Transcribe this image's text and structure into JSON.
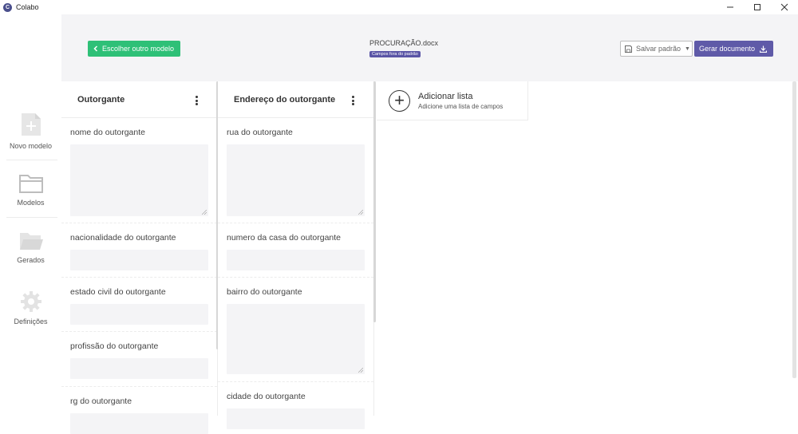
{
  "window": {
    "title": "Colabo",
    "logo_letter": "C"
  },
  "sidebar": {
    "items": [
      {
        "label": "Novo modelo",
        "icon": "new-document-icon"
      },
      {
        "label": "Modelos",
        "icon": "folder-icon"
      },
      {
        "label": "Gerados",
        "icon": "open-folder-icon"
      },
      {
        "label": "Definições",
        "icon": "gear-icon"
      }
    ]
  },
  "header": {
    "choose_label": "Escolher outro modelo",
    "document_name": "PROCURAÇÃO.docx",
    "badge": "Campos fora do padrão",
    "save_label": "Salvar padrão",
    "generate_label": "Gerar documento"
  },
  "columns": [
    {
      "title": "Outorgante",
      "fields": [
        {
          "label": "nome do outorgante",
          "type": "textarea"
        },
        {
          "label": "nacionalidade do outorgante",
          "type": "input"
        },
        {
          "label": "estado civil do outorgante",
          "type": "input"
        },
        {
          "label": "profissão do outorgante",
          "type": "input"
        },
        {
          "label": "rg do outorgante",
          "type": "input"
        }
      ]
    },
    {
      "title": "Endereço do outorgante",
      "fields": [
        {
          "label": "rua do outorgante",
          "type": "textarea"
        },
        {
          "label": "numero da casa do outorgante",
          "type": "input"
        },
        {
          "label": "bairro do outorgante",
          "type": "textarea"
        },
        {
          "label": "cidade do outorgante",
          "type": "input"
        }
      ]
    }
  ],
  "add_list": {
    "title": "Adicionar lista",
    "subtitle": "Adicione uma lista de campos"
  },
  "colors": {
    "green": "#2ec077",
    "purple": "#5f5aa8",
    "badge": "#5a55a6",
    "field_bg": "#f4f4f6"
  }
}
